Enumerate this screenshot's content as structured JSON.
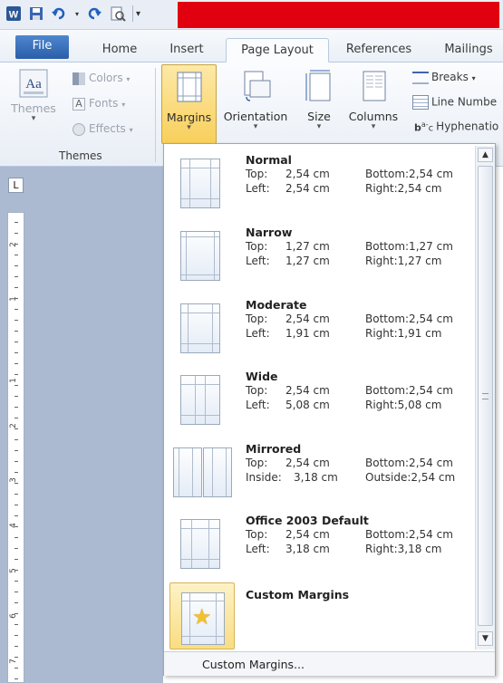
{
  "quick_access": {
    "icons": [
      "word-icon",
      "save-icon",
      "undo-icon",
      "redo-icon",
      "print-preview-icon",
      "customize-icon"
    ]
  },
  "tabs": [
    {
      "label": "File"
    },
    {
      "label": "Home"
    },
    {
      "label": "Insert"
    },
    {
      "label": "Page Layout"
    },
    {
      "label": "References"
    },
    {
      "label": "Mailings"
    }
  ],
  "themes_group": {
    "themes_label": "Themes",
    "colors_label": "Colors",
    "fonts_label": "Fonts",
    "effects_label": "Effects",
    "group_label": "Themes"
  },
  "page_setup": {
    "margins_label": "Margins",
    "orientation_label": "Orientation",
    "size_label": "Size",
    "columns_label": "Columns",
    "breaks_label": "Breaks",
    "line_numbers_label": "Line Numbe",
    "hyphenation_label": "Hyphenatio"
  },
  "ruler": {
    "corner_glyph": "L",
    "numbers": [
      "2",
      "1",
      "1",
      "2",
      "3",
      "4",
      "5",
      "6",
      "7"
    ]
  },
  "margin_presets": [
    {
      "name": "Normal",
      "row1": [
        "Top:",
        "2,54 cm",
        "Bottom:2,54 cm"
      ],
      "row2": [
        "Left:",
        "2,54 cm",
        "Right:2,54 cm"
      ]
    },
    {
      "name": "Narrow",
      "row1": [
        "Top:",
        "1,27 cm",
        "Bottom:1,27 cm"
      ],
      "row2": [
        "Left:",
        "1,27 cm",
        "Right:1,27 cm"
      ]
    },
    {
      "name": "Moderate",
      "row1": [
        "Top:",
        "2,54 cm",
        "Bottom:2,54 cm"
      ],
      "row2": [
        "Left:",
        "1,91 cm",
        "Right:1,91 cm"
      ]
    },
    {
      "name": "Wide",
      "row1": [
        "Top:",
        "2,54 cm",
        "Bottom:2,54 cm"
      ],
      "row2": [
        "Left:",
        "5,08 cm",
        "Right:5,08 cm"
      ]
    },
    {
      "name": "Mirrored",
      "row1": [
        "Top:",
        "2,54 cm",
        "Bottom:2,54 cm"
      ],
      "row2": [
        "Inside:",
        "3,18 cm",
        "Outside:2,54 cm"
      ]
    },
    {
      "name": "Office 2003 Default",
      "row1": [
        "Top:",
        "2,54 cm",
        "Bottom:2,54 cm"
      ],
      "row2": [
        "Left:",
        "3,18 cm",
        "Right:3,18 cm"
      ]
    }
  ],
  "custom_item": {
    "name": "Custom Margins"
  },
  "footer": {
    "label": "Custom Margins..."
  }
}
